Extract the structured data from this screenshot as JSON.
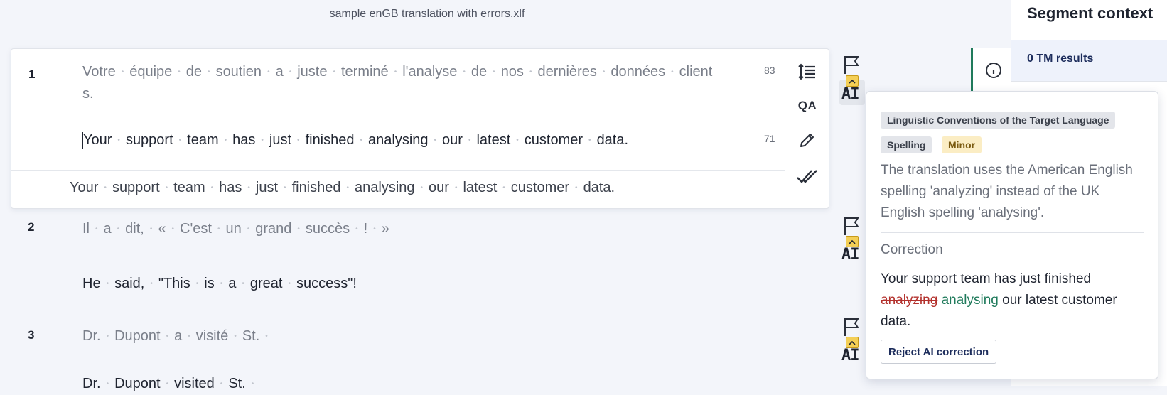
{
  "file": {
    "title": "sample enGB translation with errors.xlf"
  },
  "segments": [
    {
      "number": "1",
      "source_words": [
        "Votre",
        "équipe",
        "de",
        "soutien",
        "a",
        "juste",
        "terminé",
        "l'analyse",
        "de",
        "nos",
        "dernières",
        "données",
        "client"
      ],
      "source_wrap": "s.",
      "source_score": "83",
      "target_words": [
        "Your",
        "support",
        "team",
        "has",
        "just",
        "finished",
        "analysing",
        "our",
        "latest",
        "customer",
        "data."
      ],
      "target_score": "71",
      "preview_words": [
        "Your",
        "support",
        "team",
        "has",
        "just",
        "finished",
        "analysing",
        "our",
        "latest",
        "customer",
        "data."
      ]
    },
    {
      "number": "2",
      "source_words": [
        "Il",
        "a",
        "dit,",
        "«",
        "C'est",
        "un",
        "grand",
        "succès",
        "!",
        "»"
      ],
      "target_words": [
        "He",
        "said,",
        "\"This",
        "is",
        "a",
        "great",
        "success\"!"
      ]
    },
    {
      "number": "3",
      "source_words": [
        "Dr.",
        "Dupont",
        "a",
        "visité",
        "St.",
        ""
      ],
      "target_words": [
        "Dr.",
        "Dupont",
        "visited",
        "St.",
        ""
      ]
    }
  ],
  "tools": {
    "qa_label": "QA"
  },
  "right_panel": {
    "title": "Segment context",
    "tm_results": "0 TM results"
  },
  "popover": {
    "category": "Linguistic Conventions of the Target Language",
    "error_type": "Spelling",
    "severity": "Minor",
    "explanation": "The translation uses the American English spelling 'analyzing' instead of the UK English spelling 'analysing'.",
    "correction_label": "Correction",
    "correction_before": "Your support team has just finished",
    "correction_deleted": "analyzing",
    "correction_inserted": "analysing",
    "correction_after": "our latest customer data.",
    "reject_button": "Reject AI correction"
  },
  "ai_badge": "AI",
  "colors": {
    "accent_green": "#1f7a5b",
    "badge_yellow": "#f4cf56",
    "deleted_red": "#b3312d",
    "navy": "#1d2d5c"
  }
}
